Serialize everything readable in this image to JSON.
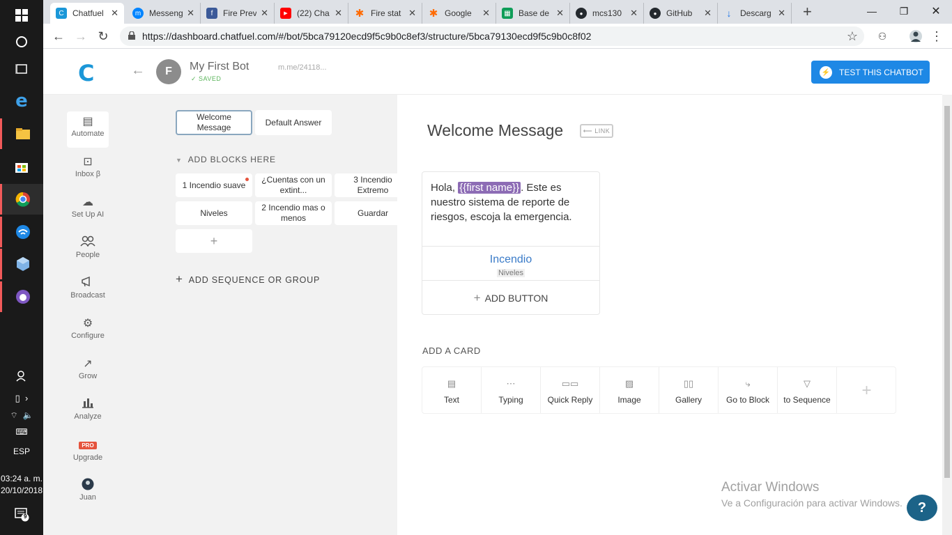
{
  "taskbar": {
    "lang": "ESP",
    "time": "03:24 a. m.",
    "date": "20/10/2018",
    "notifications": "9"
  },
  "tabs": [
    {
      "label": "Chatfuel",
      "color": "#1b97d8",
      "glyph": "C"
    },
    {
      "label": "Messenger",
      "color": "#0084ff",
      "glyph": "m"
    },
    {
      "label": "Fire Prev",
      "color": "#3b5998",
      "glyph": "f"
    },
    {
      "label": "(22) Cha",
      "color": "#ff0000",
      "glyph": "▶"
    },
    {
      "label": "Fire stat",
      "color": "#ff6a00",
      "glyph": "✱"
    },
    {
      "label": "Google",
      "color": "#ff6a00",
      "glyph": "✱"
    },
    {
      "label": "Base de",
      "color": "#0f9d58",
      "glyph": "▦"
    },
    {
      "label": "mcs130",
      "color": "#24292e",
      "glyph": "●"
    },
    {
      "label": "GitHub",
      "color": "#24292e",
      "glyph": "●"
    },
    {
      "label": "Descarg",
      "color": "#1a73e8",
      "glyph": "↓"
    }
  ],
  "address": {
    "url": "https://dashboard.chatfuel.com/#/bot/5bca79120ecd9f5c9b0c8ef3/structure/5bca79130ecd9f5c9b0c8f02"
  },
  "header": {
    "logo": "C",
    "avatar_letter": "F",
    "bot_name": "My First Bot",
    "saved": "SAVED",
    "mme_link": "m.me/24118...",
    "test_button": "TEST THIS CHATBOT"
  },
  "sidenav": [
    {
      "label": "Automate",
      "icon": "robot-icon",
      "glyph": "▤"
    },
    {
      "label": "Inbox β",
      "icon": "inbox-icon",
      "glyph": "⊡"
    },
    {
      "label": "Set Up AI",
      "icon": "brain-icon",
      "glyph": "☁"
    },
    {
      "label": "People",
      "icon": "people-icon",
      "glyph": "👥"
    },
    {
      "label": "Broadcast",
      "icon": "megaphone-icon",
      "glyph": "📢"
    },
    {
      "label": "Configure",
      "icon": "gear-icon",
      "glyph": "⚙"
    },
    {
      "label": "Grow",
      "icon": "grow-icon",
      "glyph": "↗"
    },
    {
      "label": "Analyze",
      "icon": "bar-chart-icon",
      "glyph": "▥"
    },
    {
      "label": "Upgrade",
      "icon": "pro-badge",
      "glyph": "PRO"
    },
    {
      "label": "Juan",
      "icon": "user-avatar",
      "glyph": "●"
    }
  ],
  "blocks": {
    "top": [
      "Welcome Message",
      "Default Answer"
    ],
    "section_label": "ADD BLOCKS HERE",
    "items": [
      {
        "label": "1 Incendio suave",
        "dot": true
      },
      {
        "label": "¿Cuentas con un extint...",
        "dot": false
      },
      {
        "label": "3 Incendio Extremo",
        "dot": true
      },
      {
        "label": "Niveles",
        "dot": false
      },
      {
        "label": "2 Incendio mas o menos",
        "dot": false
      },
      {
        "label": "Guardar",
        "dot": false
      }
    ],
    "add_block": "+",
    "add_sequence": "ADD SEQUENCE OR GROUP"
  },
  "editor": {
    "title": "Welcome Message",
    "link_badge": "LINK",
    "card_text_before": "Hola, ",
    "card_attribute": "{{first name}}",
    "card_text_after": ". Este es nuestro sistema de reporte de riesgos, escoja la emergencia.",
    "button_title": "Incendio",
    "button_target": "Niveles",
    "add_button": "ADD BUTTON",
    "add_card_label": "ADD A CARD",
    "card_types": [
      {
        "label": "Text",
        "icon": "text-icon",
        "glyph": "▤"
      },
      {
        "label": "Typing",
        "icon": "typing-icon",
        "glyph": "⋯"
      },
      {
        "label": "Quick Reply",
        "icon": "quick-reply-icon",
        "glyph": "▭▭"
      },
      {
        "label": "Image",
        "icon": "image-icon",
        "glyph": "▨"
      },
      {
        "label": "Gallery",
        "icon": "gallery-icon",
        "glyph": "▯▯"
      },
      {
        "label": "Go to Block",
        "icon": "go-to-block-icon",
        "glyph": "⤷"
      },
      {
        "label": "to Sequence",
        "icon": "filter-icon",
        "glyph": "▽"
      },
      {
        "label": "",
        "icon": "plus-icon",
        "glyph": "+"
      }
    ]
  },
  "watermark": {
    "line1": "Activar Windows",
    "line2": "Ve a Configuración para activar Windows."
  },
  "help": "?"
}
